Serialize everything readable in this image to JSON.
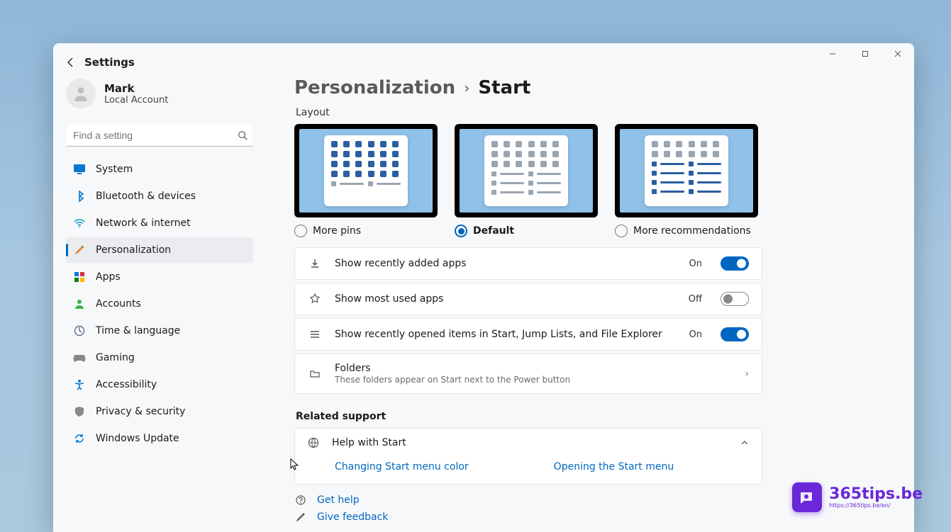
{
  "app_title": "Settings",
  "account": {
    "name": "Mark",
    "type": "Local Account"
  },
  "search": {
    "placeholder": "Find a setting"
  },
  "sidebar": {
    "items": [
      {
        "label": "System"
      },
      {
        "label": "Bluetooth & devices"
      },
      {
        "label": "Network & internet"
      },
      {
        "label": "Personalization"
      },
      {
        "label": "Apps"
      },
      {
        "label": "Accounts"
      },
      {
        "label": "Time & language"
      },
      {
        "label": "Gaming"
      },
      {
        "label": "Accessibility"
      },
      {
        "label": "Privacy & security"
      },
      {
        "label": "Windows Update"
      }
    ]
  },
  "breadcrumb": {
    "parent": "Personalization",
    "current": "Start"
  },
  "layout": {
    "heading": "Layout",
    "options": [
      {
        "label": "More pins"
      },
      {
        "label": "Default"
      },
      {
        "label": "More recommendations"
      }
    ]
  },
  "settings": {
    "recent_apps": {
      "label": "Show recently added apps",
      "state": "On"
    },
    "most_used": {
      "label": "Show most used apps",
      "state": "Off"
    },
    "recent_items": {
      "label": "Show recently opened items in Start, Jump Lists, and File Explorer",
      "state": "On"
    },
    "folders": {
      "title": "Folders",
      "sub": "These folders appear on Start next to the Power button"
    }
  },
  "related": {
    "heading": "Related support",
    "help_title": "Help with Start",
    "links": [
      "Changing Start menu color",
      "Opening the Start menu"
    ]
  },
  "footer": {
    "get_help": "Get help",
    "feedback": "Give feedback"
  },
  "watermark": {
    "text": "365tips.be",
    "sub": "https://365tips.be/en/"
  }
}
